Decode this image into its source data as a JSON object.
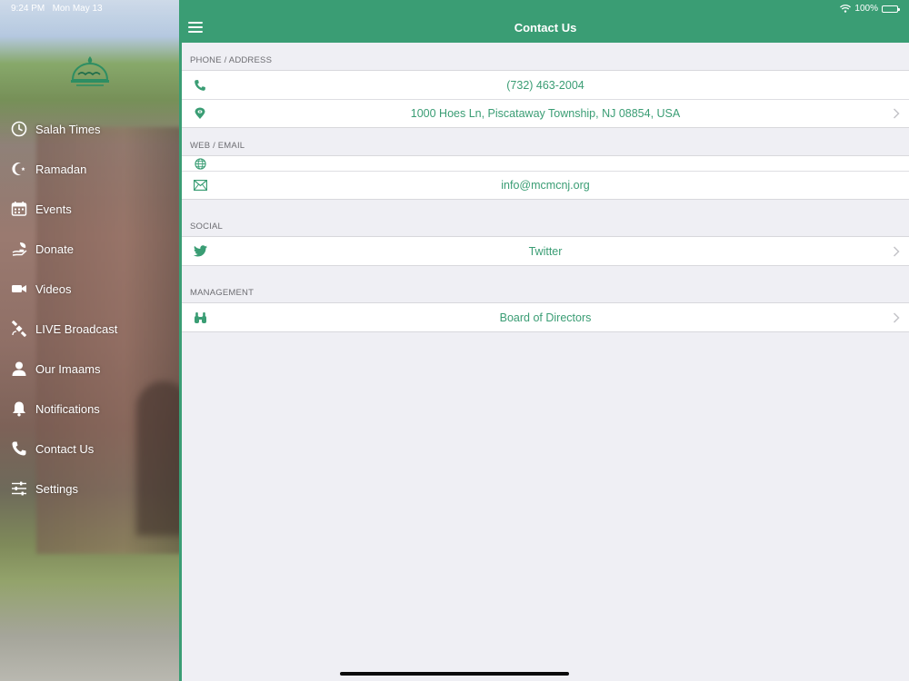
{
  "status_bar": {
    "time": "9:24 PM",
    "date": "Mon May 13",
    "battery": "100%",
    "battery_level": 1.0
  },
  "colors": {
    "accent": "#3a9d74",
    "background": "#efeff4",
    "text_muted": "#6d6d72"
  },
  "sidebar": {
    "items": [
      {
        "label": "Salah Times",
        "icon": "clock-icon"
      },
      {
        "label": "Ramadan",
        "icon": "crescent-star-icon"
      },
      {
        "label": "Events",
        "icon": "calendar-icon"
      },
      {
        "label": "Donate",
        "icon": "donate-icon"
      },
      {
        "label": "Videos",
        "icon": "video-camera-icon"
      },
      {
        "label": "LIVE Broadcast",
        "icon": "satellite-icon"
      },
      {
        "label": "Our Imaams",
        "icon": "person-icon"
      },
      {
        "label": "Notifications",
        "icon": "bell-icon"
      },
      {
        "label": "Contact Us",
        "icon": "phone-icon"
      },
      {
        "label": "Settings",
        "icon": "sliders-icon"
      }
    ]
  },
  "header": {
    "title": "Contact Us",
    "menu_icon": "hamburger-icon"
  },
  "sections": [
    {
      "title": "PHONE / ADDRESS",
      "rows": [
        {
          "text": "(732) 463-2004",
          "icon": "phone-icon",
          "chevron": false
        },
        {
          "text": "1000 Hoes Ln, Piscataway Township, NJ 08854, USA",
          "icon": "map-pin-icon",
          "chevron": true
        }
      ]
    },
    {
      "title": "WEB / EMAIL",
      "rows": [
        {
          "text": "",
          "icon": "globe-icon",
          "chevron": false
        },
        {
          "text": "info@mcmcnj.org",
          "icon": "envelope-icon",
          "chevron": false
        }
      ]
    },
    {
      "title": "SOCIAL",
      "rows": [
        {
          "text": "Twitter",
          "icon": "twitter-icon",
          "chevron": true
        }
      ]
    },
    {
      "title": "MANAGEMENT",
      "rows": [
        {
          "text": "Board of Directors",
          "icon": "binoculars-icon",
          "chevron": true
        }
      ]
    }
  ]
}
